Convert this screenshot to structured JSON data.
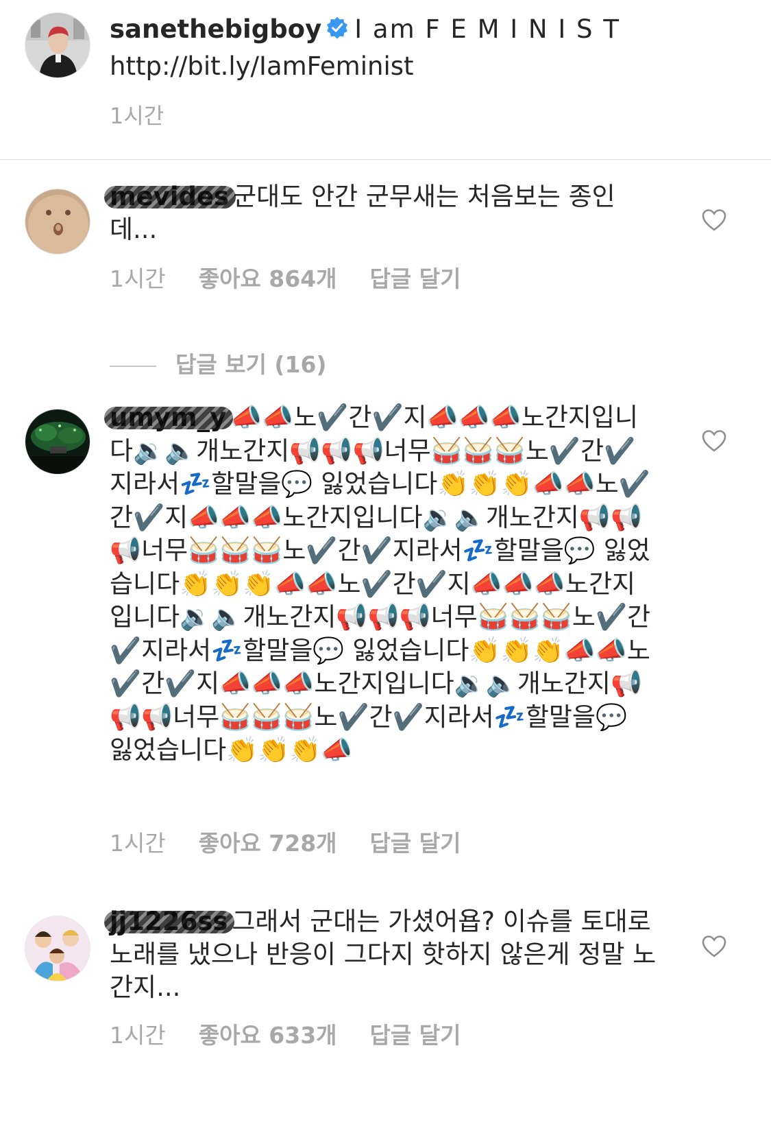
{
  "caption": {
    "username": "sanethebigboy",
    "body": "I am F E M I N I S T",
    "link": "http://bit.ly/IamFeminist",
    "time": "1시간",
    "verified_icon": "verified-badge-icon",
    "accent": "#3897f0"
  },
  "view_replies": "답글 보기 (16)",
  "comments": [
    {
      "username": "mevides",
      "text": "군대도 안간 군무새는 처음보는 종인데...",
      "time": "1시간",
      "likes": "좋아요 864개",
      "reply": "답글 달기"
    },
    {
      "username": "umym_y",
      "text": "📣📣노✔️간✔️지📣📣📣노간지입니다🔉🔈개노간지📢📢📢너무🥁🥁🥁노✔️간✔️지라서💤할말을💬 잃었습니다👏👏👏📣📣노✔️간✔️지📣📣📣노간지입니다🔉🔈개노간지📢📢📢너무🥁🥁🥁노✔️간✔️지라서💤할말을💬 잃었습니다👏👏👏📣📣노✔️간✔️지📣📣📣노간지입니다🔉🔈개노간지📢📢📢너무🥁🥁🥁노✔️간✔️지라서💤할말을💬 잃었습니다👏👏👏📣📣노✔️간✔️지📣📣📣노간지입니다🔉🔈개노간지📢📢📢너무🥁🥁🥁노✔️간✔️지라서💤할말을💬 잃었습니다👏👏👏📣",
      "time": "1시간",
      "likes": "좋아요 728개",
      "reply": "답글 달기"
    },
    {
      "username": "jj1226ss",
      "text": "그래서 군대는 가셨어욥? 이슈를 토대로 노래를 냈으나 반응이 그다지 핫하지 않은게 정말 노간지...",
      "time": "1시간",
      "likes": "좋아요 633개",
      "reply": "답글 달기"
    }
  ]
}
